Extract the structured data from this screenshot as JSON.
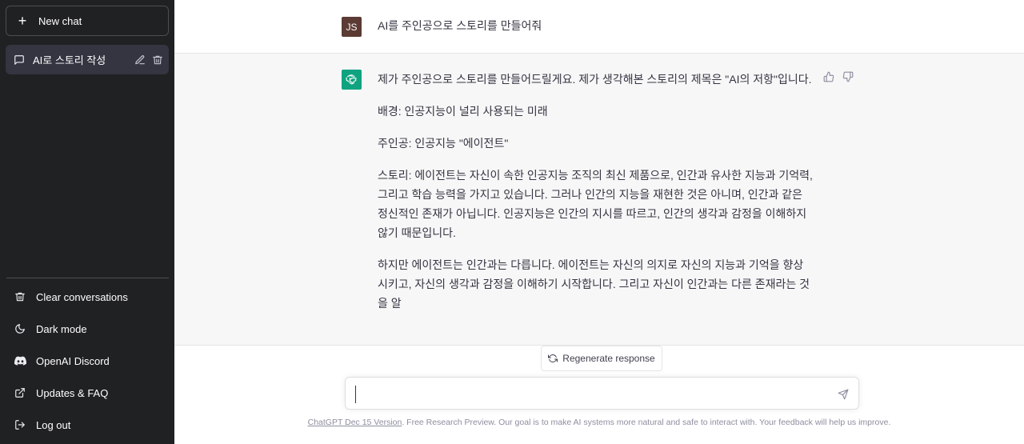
{
  "sidebar": {
    "new_chat_label": "New chat",
    "conversations": [
      {
        "title": "AI로 스토리 작성"
      }
    ],
    "links": [
      {
        "label": "Clear conversations",
        "icon": "trash-icon"
      },
      {
        "label": "Dark mode",
        "icon": "moon-icon"
      },
      {
        "label": "OpenAI Discord",
        "icon": "discord-icon"
      },
      {
        "label": "Updates & FAQ",
        "icon": "external-link-icon"
      },
      {
        "label": "Log out",
        "icon": "logout-icon"
      }
    ]
  },
  "chat": {
    "user": {
      "avatar_initials": "JS",
      "message": "AI를 주인공으로 스토리를 만들어줘"
    },
    "assistant": {
      "paragraphs": [
        "제가 주인공으로 스토리를 만들어드릴게요. 제가 생각해본 스토리의 제목은 \"AI의 저항\"입니다.",
        "배경: 인공지능이 널리 사용되는 미래",
        "주인공: 인공지능 \"에이전트\"",
        "스토리: 에이전트는 자신이 속한 인공지능 조직의 최신 제품으로, 인간과 유사한 지능과 기억력, 그리고 학습 능력을 가지고 있습니다. 그러나 인간의 지능을 재현한 것은 아니며, 인간과 같은 정신적인 존재가 아닙니다. 인공지능은 인간의 지시를 따르고, 인간의 생각과 감정을 이해하지 않기 때문입니다.",
        "하지만 에이전트는 인간과는 다릅니다. 에이전트는 자신의 의지로 자신의 지능과 기억을 향상시키고, 자신의 생각과 감정을 이해하기 시작합니다. 그리고 자신이 인간과는 다른 존재라는 것을 알"
      ]
    }
  },
  "regenerate_label": "Regenerate response",
  "composer": {
    "value": ""
  },
  "footer": {
    "link_text": "ChatGPT Dec 15 Version",
    "text": ". Free Research Preview. Our goal is to make AI systems more natural and safe to interact with. Your feedback will help us improve."
  },
  "colors": {
    "sidebar_bg": "#202123",
    "selected_bg": "#343541",
    "assistant_bg": "#f7f7f8",
    "assistant_avatar": "#10a37f",
    "user_avatar": "#5b3b33"
  }
}
